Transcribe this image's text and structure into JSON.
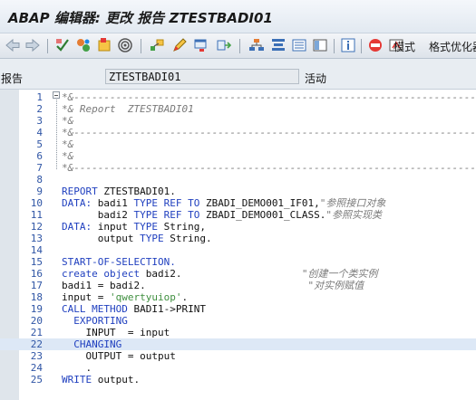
{
  "window": {
    "title": "ABAP 编辑器: 更改 报告 ZTESTBADI01"
  },
  "toolbar": {
    "icons": [
      "back-icon",
      "forward-icon",
      "check-syntax-icon",
      "other-object-icon",
      "activate-icon",
      "test-run-icon",
      "where-used-icon",
      "display-change-icon",
      "edit-icon",
      "mark-icon",
      "object-list-icon",
      "navigation-window-icon",
      "help-icon",
      "breakpoint-icon",
      "enhance-icon"
    ],
    "mode_label": "模式",
    "pretty_printer_label": "格式优化器"
  },
  "fields": {
    "report_label": "报告",
    "report_value": "ZTESTBADI01",
    "status_value": "活动"
  },
  "editor": {
    "lines": [
      {
        "n": "1",
        "segs": [
          {
            "t": "cmt",
            "v": "*&---------------------------------------------------------------------"
          }
        ]
      },
      {
        "n": "2",
        "segs": [
          {
            "t": "cmt",
            "v": "*& Report  ZTESTBADI01"
          }
        ]
      },
      {
        "n": "3",
        "segs": [
          {
            "t": "cmt",
            "v": "*&"
          }
        ]
      },
      {
        "n": "4",
        "segs": [
          {
            "t": "cmt",
            "v": "*&---------------------------------------------------------------------"
          }
        ]
      },
      {
        "n": "5",
        "segs": [
          {
            "t": "cmt",
            "v": "*&"
          }
        ]
      },
      {
        "n": "6",
        "segs": [
          {
            "t": "cmt",
            "v": "*&"
          }
        ]
      },
      {
        "n": "7",
        "segs": [
          {
            "t": "cmt",
            "v": "*&---------------------------------------------------------------------"
          }
        ]
      },
      {
        "n": "8",
        "segs": []
      },
      {
        "n": "9",
        "segs": [
          {
            "t": "kw",
            "v": "REPORT"
          },
          {
            "t": "plain",
            "v": " ZTESTBADI01."
          }
        ]
      },
      {
        "n": "10",
        "segs": [
          {
            "t": "kw",
            "v": "DATA:"
          },
          {
            "t": "plain",
            "v": " badi1 "
          },
          {
            "t": "kw",
            "v": "TYPE REF TO"
          },
          {
            "t": "plain",
            "v": " ZBADI_DEMO001_IF01,"
          },
          {
            "t": "cmt",
            "v": "\"参照接口对象"
          }
        ]
      },
      {
        "n": "11",
        "segs": [
          {
            "t": "plain",
            "v": "      badi2 "
          },
          {
            "t": "kw",
            "v": "TYPE REF TO"
          },
          {
            "t": "plain",
            "v": " ZBADI_DEMO001_CLASS."
          },
          {
            "t": "cmt",
            "v": "\"参照实现类"
          }
        ]
      },
      {
        "n": "12",
        "segs": [
          {
            "t": "kw",
            "v": "DATA:"
          },
          {
            "t": "plain",
            "v": " input "
          },
          {
            "t": "kw",
            "v": "TYPE"
          },
          {
            "t": "plain",
            "v": " String,"
          }
        ]
      },
      {
        "n": "13",
        "segs": [
          {
            "t": "plain",
            "v": "      output "
          },
          {
            "t": "kw",
            "v": "TYPE"
          },
          {
            "t": "plain",
            "v": " String."
          }
        ]
      },
      {
        "n": "14",
        "segs": []
      },
      {
        "n": "15",
        "segs": [
          {
            "t": "kw",
            "v": "START-OF-SELECTION."
          }
        ]
      },
      {
        "n": "16",
        "segs": [
          {
            "t": "kw",
            "v": "create object"
          },
          {
            "t": "plain",
            "v": " badi2.                    "
          },
          {
            "t": "cmt",
            "v": "\"创建一个类实例"
          }
        ]
      },
      {
        "n": "17",
        "segs": [
          {
            "t": "plain",
            "v": "badi1 = badi2.                           "
          },
          {
            "t": "cmt",
            "v": "\"对实例赋值"
          }
        ]
      },
      {
        "n": "18",
        "segs": [
          {
            "t": "plain",
            "v": "input = "
          },
          {
            "t": "str",
            "v": "'qwertyuiop'"
          },
          {
            "t": "plain",
            "v": "."
          }
        ]
      },
      {
        "n": "19",
        "segs": [
          {
            "t": "kw",
            "v": "CALL METHOD"
          },
          {
            "t": "plain",
            "v": " BADI1->PRINT"
          }
        ]
      },
      {
        "n": "20",
        "segs": [
          {
            "t": "kw",
            "v": "  EXPORTING"
          }
        ]
      },
      {
        "n": "21",
        "segs": [
          {
            "t": "plain",
            "v": "    INPUT  = input"
          }
        ]
      },
      {
        "n": "22",
        "hl": true,
        "segs": [
          {
            "t": "kw",
            "v": "  CHANGING"
          }
        ]
      },
      {
        "n": "23",
        "segs": [
          {
            "t": "plain",
            "v": "    OUTPUT = output"
          }
        ]
      },
      {
        "n": "24",
        "segs": [
          {
            "t": "plain",
            "v": "    ."
          }
        ]
      },
      {
        "n": "25",
        "segs": [
          {
            "t": "kw",
            "v": "WRITE"
          },
          {
            "t": "plain",
            "v": " output."
          }
        ]
      }
    ]
  }
}
